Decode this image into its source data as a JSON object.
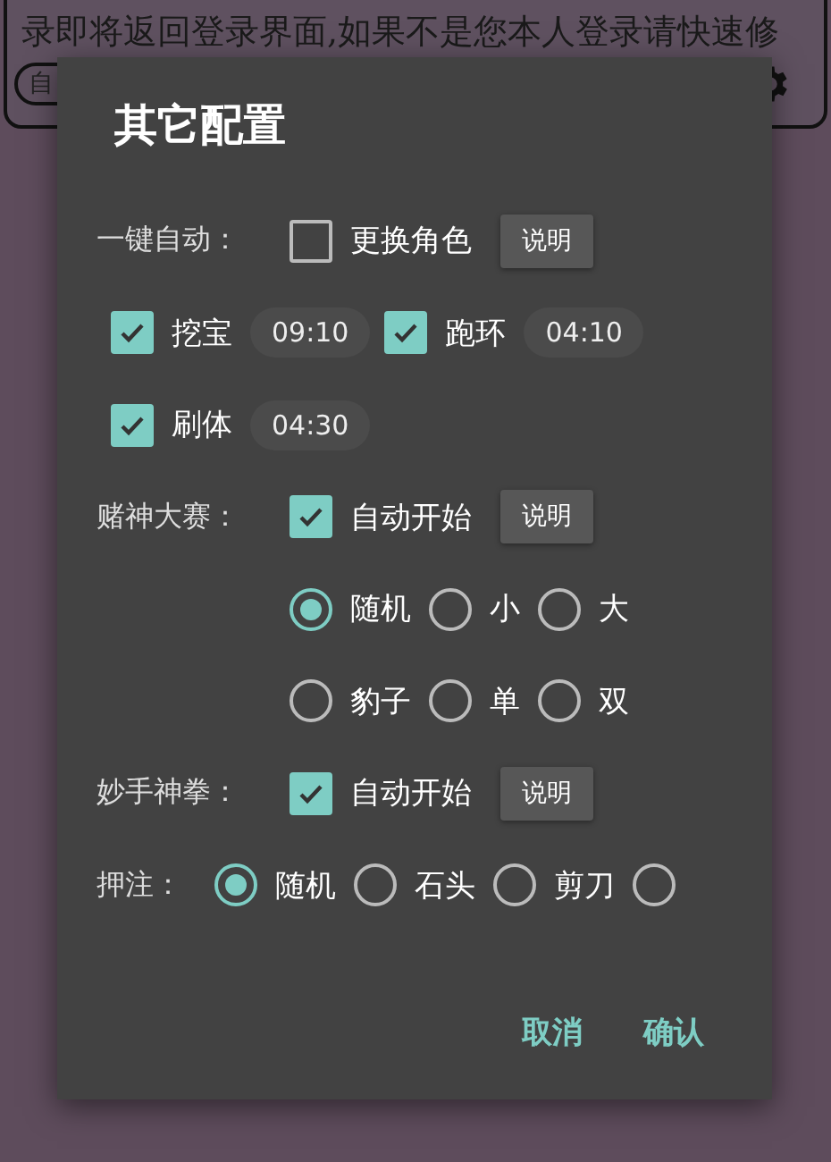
{
  "background": {
    "notice": "录即将返回登录界面,如果不是您本人登录请快速修",
    "field_text": "自"
  },
  "dialog": {
    "title": "其它配置",
    "rows": [
      {
        "kind": "option",
        "label": "一键自动：",
        "check": {
          "label": "更换角色",
          "checked": false
        },
        "button": "说明"
      },
      {
        "kind": "tasks",
        "tasks": [
          {
            "label": "挖宝",
            "checked": true,
            "time": "09:10"
          },
          {
            "label": "跑环",
            "checked": true,
            "time": "04:10"
          }
        ]
      },
      {
        "kind": "tasks",
        "tasks": [
          {
            "label": "刷体",
            "checked": true,
            "time": "04:30"
          }
        ]
      },
      {
        "kind": "option",
        "label": "赌神大赛：",
        "check": {
          "label": "自动开始",
          "checked": true
        },
        "button": "说明"
      },
      {
        "kind": "radios",
        "choices": [
          {
            "label": "随机",
            "selected": true
          },
          {
            "label": "小",
            "selected": false
          },
          {
            "label": "大",
            "selected": false
          }
        ]
      },
      {
        "kind": "radios",
        "choices": [
          {
            "label": "豹子",
            "selected": false
          },
          {
            "label": "单",
            "selected": false
          },
          {
            "label": "双",
            "selected": false
          }
        ]
      },
      {
        "kind": "option",
        "label": "妙手神拳：",
        "check": {
          "label": "自动开始",
          "checked": true
        },
        "button": "说明"
      },
      {
        "kind": "radios",
        "label": "押注：",
        "choices": [
          {
            "label": "随机",
            "selected": true
          },
          {
            "label": "石头",
            "selected": false
          },
          {
            "label": "剪刀",
            "selected": false
          },
          {
            "selected": false
          }
        ]
      }
    ],
    "actions": [
      "取消",
      "确认"
    ]
  }
}
